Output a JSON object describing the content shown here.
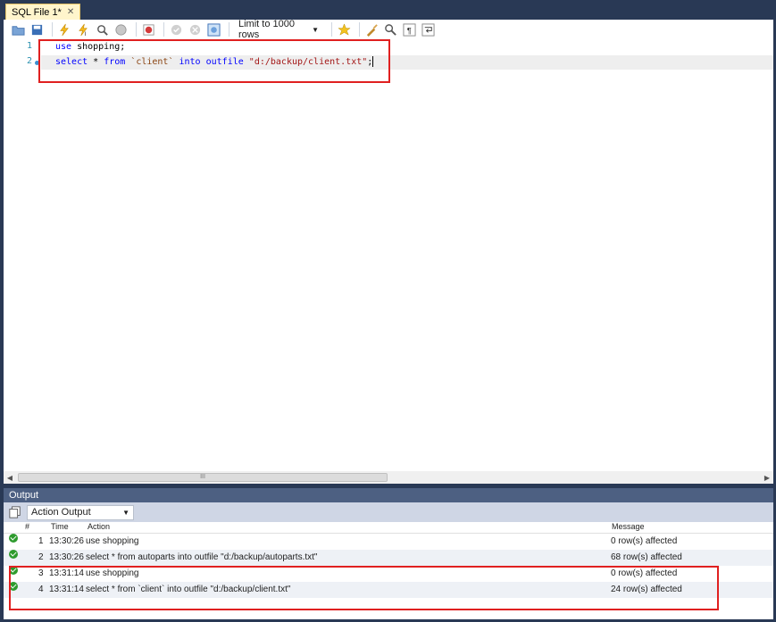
{
  "tab": {
    "title": "SQL File 1*",
    "close": "✕"
  },
  "toolbar": {
    "limit_label": "Limit to 1000 rows",
    "icons": [
      "open-folder-icon",
      "save-icon",
      "execute-icon",
      "execute-current-icon",
      "explain-icon",
      "stop-icon",
      "toggle-error-icon",
      "commit-icon",
      "rollback-icon",
      "autocommit-icon",
      "bookmark-icon",
      "beautify-icon",
      "find-icon",
      "invisible-chars-icon",
      "wrap-icon"
    ]
  },
  "editor": {
    "lines": [
      {
        "num": "1",
        "parts": [
          {
            "t": "use",
            "c": "kw"
          },
          {
            "t": " shopping;",
            "c": "id"
          }
        ]
      },
      {
        "num": "2",
        "parts": [
          {
            "t": "select",
            "c": "kw"
          },
          {
            "t": " * ",
            "c": "id"
          },
          {
            "t": "from",
            "c": "kw"
          },
          {
            "t": " `client` ",
            "c": "bt"
          },
          {
            "t": "into",
            "c": "kw"
          },
          {
            "t": " ",
            "c": "id"
          },
          {
            "t": "outfile",
            "c": "kw"
          },
          {
            "t": " \"d:/backup/client.txt\"",
            "c": "str"
          },
          {
            "t": ";",
            "c": "id"
          }
        ]
      }
    ]
  },
  "scroll": {
    "thumb_grip": "III"
  },
  "output": {
    "title": "Output",
    "selector": "Action Output",
    "columns": {
      "num": "#",
      "time": "Time",
      "action": "Action",
      "message": "Message"
    },
    "rows": [
      {
        "num": "1",
        "time": "13:30:26",
        "action": "use shopping",
        "message": "0 row(s) affected"
      },
      {
        "num": "2",
        "time": "13:30:26",
        "action": "select * from autoparts into outfile \"d:/backup/autoparts.txt\"",
        "message": "68 row(s) affected"
      },
      {
        "num": "3",
        "time": "13:31:14",
        "action": "use shopping",
        "message": "0 row(s) affected"
      },
      {
        "num": "4",
        "time": "13:31:14",
        "action": "select * from `client` into outfile \"d:/backup/client.txt\"",
        "message": "24 row(s) affected"
      }
    ]
  }
}
